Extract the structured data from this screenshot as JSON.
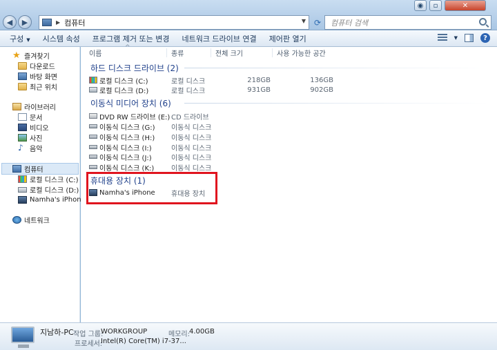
{
  "address": {
    "crumb": "컴퓨터"
  },
  "search": {
    "placeholder": "컴퓨터 검색"
  },
  "toolbar": {
    "organize": "구성",
    "system_props": "시스템 속성",
    "uninstall": "프로그램 제거 또는 변경",
    "map_drive": "네트워크 드라이브 연결",
    "control_panel": "제어판 열기"
  },
  "nav": {
    "favorites": "즐겨찾기",
    "downloads": "다운로드",
    "desktop": "바탕 화면",
    "recent": "최근 위치",
    "libraries": "라이브러리",
    "documents": "문서",
    "videos": "비디오",
    "pictures": "사진",
    "music": "음악",
    "computer": "컴퓨터",
    "drive_c": "로컬 디스크 (C:)",
    "drive_d": "로컬 디스크 (D:)",
    "iphone": "Namha's iPhone",
    "network": "네트워크"
  },
  "columns": {
    "name": "이름",
    "type": "종류",
    "total": "전체 크기",
    "free": "사용 가능한 공간"
  },
  "groups": {
    "hdd": "하드 디스크 드라이브 (2)",
    "removable": "이동식 미디어 장치 (6)",
    "portable": "휴대용 장치 (1)"
  },
  "hdd_rows": [
    {
      "name": "로컬 디스크 (C:)",
      "type": "로컬 디스크",
      "total": "218GB",
      "free": "136GB"
    },
    {
      "name": "로컬 디스크 (D:)",
      "type": "로컬 디스크",
      "total": "931GB",
      "free": "902GB"
    }
  ],
  "removable_rows": [
    {
      "name": "DVD RW 드라이브 (E:)",
      "type": "CD 드라이브"
    },
    {
      "name": "이동식 디스크 (G:)",
      "type": "이동식 디스크"
    },
    {
      "name": "이동식 디스크 (H:)",
      "type": "이동식 디스크"
    },
    {
      "name": "이동식 디스크 (I:)",
      "type": "이동식 디스크"
    },
    {
      "name": "이동식 디스크 (J:)",
      "type": "이동식 디스크"
    },
    {
      "name": "이동식 디스크 (K:)",
      "type": "이동식 디스크"
    }
  ],
  "portable_rows": [
    {
      "name": "Namha's iPhone",
      "type": "휴대용 장치"
    }
  ],
  "details": {
    "pc_name": "지남하-PC",
    "workgroup_label": "작업 그룹:",
    "workgroup": "WORKGROUP",
    "memory_label": "메모리:",
    "memory": "4.00GB",
    "cpu_label": "프로세서:",
    "cpu": "Intel(R) Core(TM) i7-37..."
  },
  "colors": {
    "highlight": "#e0141e",
    "group_text": "#1e3f8a"
  }
}
